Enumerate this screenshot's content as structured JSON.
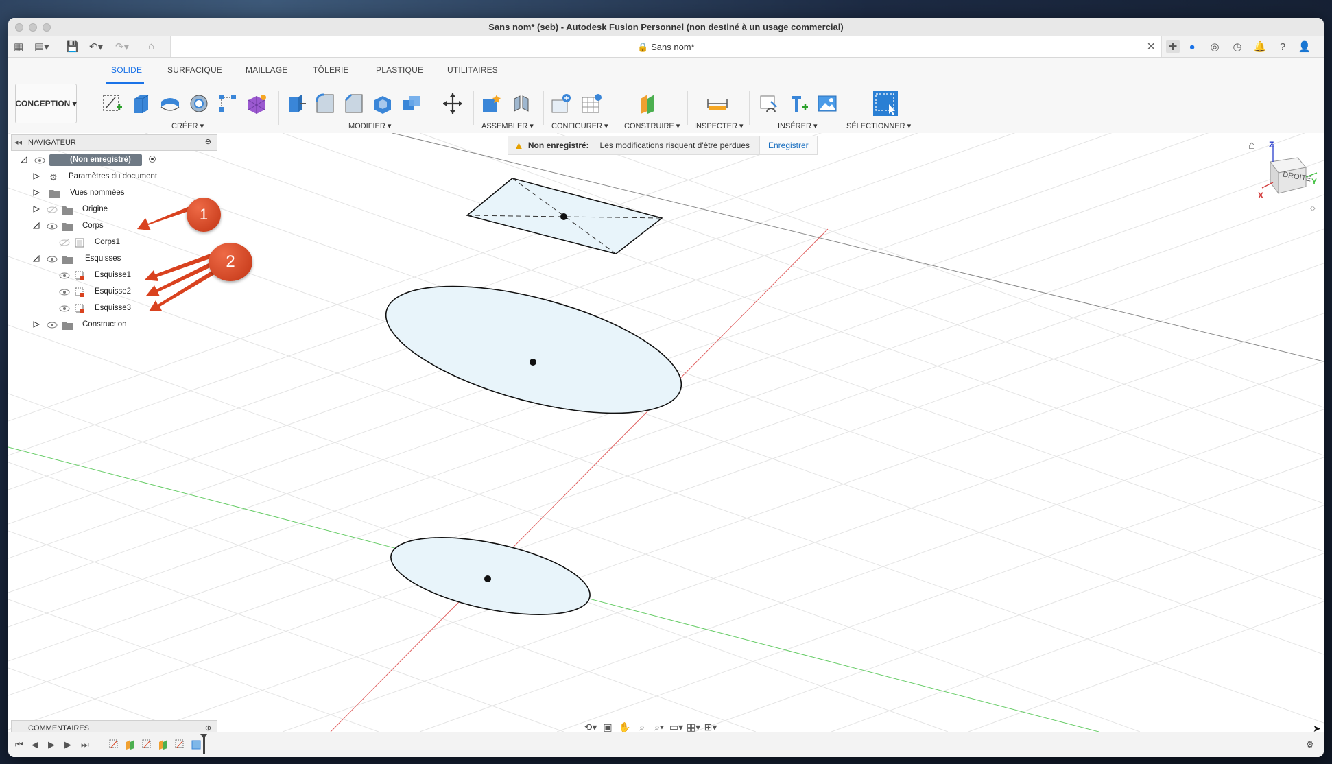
{
  "window": {
    "title": "Sans nom* (seb) - Autodesk Fusion Personnel (non destiné à un usage commercial)"
  },
  "doc_tab": {
    "title": "Sans nom*",
    "lock_icon": "lock-icon",
    "close_label": "✕"
  },
  "workspace": {
    "label": "CONCEPTION"
  },
  "ribbon_tabs": [
    "SOLIDE",
    "SURFACIQUE",
    "MAILLAGE",
    "TÔLERIE",
    "PLASTIQUE",
    "UTILITAIRES"
  ],
  "active_tab": "SOLIDE",
  "groups": [
    "CRÉER",
    "MODIFIER",
    "ASSEMBLER",
    "CONFIGURER",
    "CONSTRUIRE",
    "INSPECTER",
    "INSÉRER",
    "SÉLECTIONNER"
  ],
  "navigator": {
    "title": "NAVIGATEUR",
    "root": "(Non enregistré)",
    "items": {
      "params": "Paramètres du document",
      "views": "Vues nommées",
      "origin": "Origine",
      "bodies": "Corps",
      "body1": "Corps1",
      "sketches": "Esquisses",
      "sketch1": "Esquisse1",
      "sketch2": "Esquisse2",
      "sketch3": "Esquisse3",
      "construction": "Construction"
    }
  },
  "warning": {
    "label": "Non enregistré:",
    "message": "Les modifications risquent d'être perdues",
    "action": "Enregistrer"
  },
  "viewcube": {
    "face": "DROITE",
    "axis_z": "Z",
    "axis_x": "X",
    "axis_y": "Y"
  },
  "annotations": {
    "marker1": "1",
    "marker2": "2"
  },
  "comments": {
    "title": "COMMENTAIRES"
  },
  "colors": {
    "accent": "#1a73e8",
    "marker": "#d9421f",
    "sketch_fill": "#e8f4fa",
    "x_axis": "#e06060",
    "y_axis": "#66cc66"
  }
}
